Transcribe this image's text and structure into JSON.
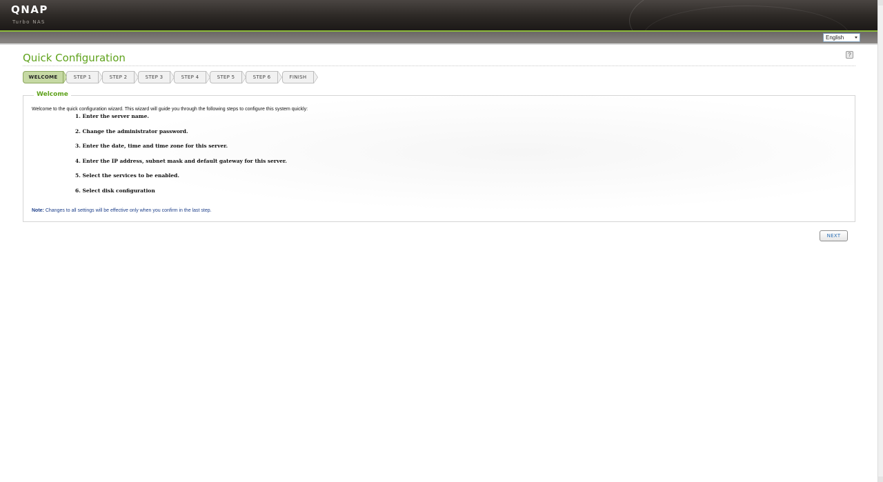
{
  "header": {
    "logo": "QNAP",
    "logo_sub": "Turbo NAS",
    "language": "English"
  },
  "page": {
    "title": "Quick Configuration",
    "help_icon": "help-icon"
  },
  "steps": [
    {
      "label": "WELCOME",
      "active": true
    },
    {
      "label": "STEP 1",
      "active": false
    },
    {
      "label": "STEP 2",
      "active": false
    },
    {
      "label": "STEP 3",
      "active": false
    },
    {
      "label": "STEP 4",
      "active": false
    },
    {
      "label": "STEP 5",
      "active": false
    },
    {
      "label": "STEP 6",
      "active": false
    },
    {
      "label": "FINISH",
      "active": false
    }
  ],
  "welcome": {
    "legend": "Welcome",
    "intro": "Welcome to the quick configuration wizard. This wizard will guide you through the following steps to configure this system quickly:",
    "items": [
      "1. Enter the server name.",
      "2. Change the administrator password.",
      "3. Enter the date, time and time zone for this server.",
      "4. Enter the IP address, subnet mask and default gateway for this server.",
      "5. Select the services to be enabled.",
      "6. Select disk configuration"
    ],
    "note_label": "Note:",
    "note_text": " Changes to all settings will be effective only when you confirm in the last step."
  },
  "actions": {
    "next_label": "NEXT"
  },
  "colors": {
    "accent_green": "#5ea21b",
    "header_line": "#8dbb3a",
    "active_step": "#c6d9a4",
    "note_blue": "#1d3f8a",
    "button_text": "#2b6fb5"
  }
}
